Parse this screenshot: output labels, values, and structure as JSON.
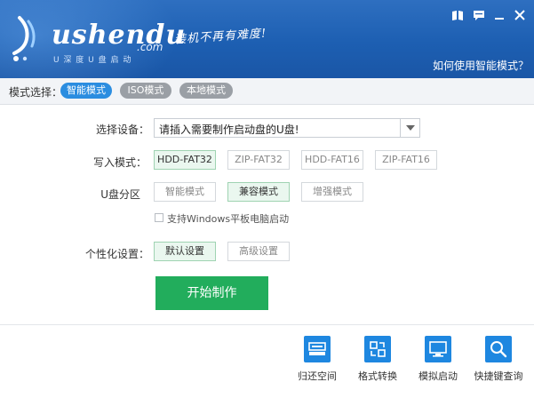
{
  "header": {
    "logo_text": "ushendu",
    "logo_com": ".com",
    "logo_sub": "U 深 度 U 盘 启 动",
    "slogan": "装机不再有难度!",
    "help_link": "如何使用智能模式？"
  },
  "window_controls": {
    "icons": [
      "book-icon",
      "message-icon",
      "minimize-icon",
      "close-icon"
    ]
  },
  "modebar": {
    "label": "模式选择：",
    "modes": [
      {
        "label": "智能模式",
        "active": true
      },
      {
        "label": "ISO模式",
        "active": false
      },
      {
        "label": "本地模式",
        "active": false
      }
    ]
  },
  "form": {
    "device_label": "选择设备：",
    "device_value": "请插入需要制作启动盘的U盘!",
    "write_label": "写入模式：",
    "write_options": [
      {
        "label": "HDD-FAT32",
        "selected": true
      },
      {
        "label": "ZIP-FAT32",
        "selected": false
      },
      {
        "label": "HDD-FAT16",
        "selected": false
      },
      {
        "label": "ZIP-FAT16",
        "selected": false
      }
    ],
    "partition_label": "U盘分区",
    "partition_options": [
      {
        "label": "智能模式",
        "selected": false
      },
      {
        "label": "兼容模式",
        "selected": true
      },
      {
        "label": "增强模式",
        "selected": false
      }
    ],
    "tablet_checkbox_label": "支持Windows平板电脑启动",
    "tablet_checkbox_checked": false,
    "personal_label": "个性化设置：",
    "personal_options": [
      {
        "label": "默认设置",
        "selected": true
      },
      {
        "label": "高级设置",
        "selected": false
      }
    ],
    "start_button": "开始制作"
  },
  "tools": [
    {
      "label": "归还空间",
      "icon": "drive-restore-icon"
    },
    {
      "label": "格式转换",
      "icon": "format-convert-icon"
    },
    {
      "label": "模拟启动",
      "icon": "monitor-simulate-icon"
    },
    {
      "label": "快捷键查询",
      "icon": "hotkey-search-icon"
    }
  ],
  "colors": {
    "header_blue": "#1d5fb2",
    "active_blue": "#2b8de0",
    "inactive_gray": "#9a9fa5",
    "start_green": "#22ad5c",
    "selected_bg": "#eaf7ef",
    "tool_blue": "#1e87e0"
  }
}
